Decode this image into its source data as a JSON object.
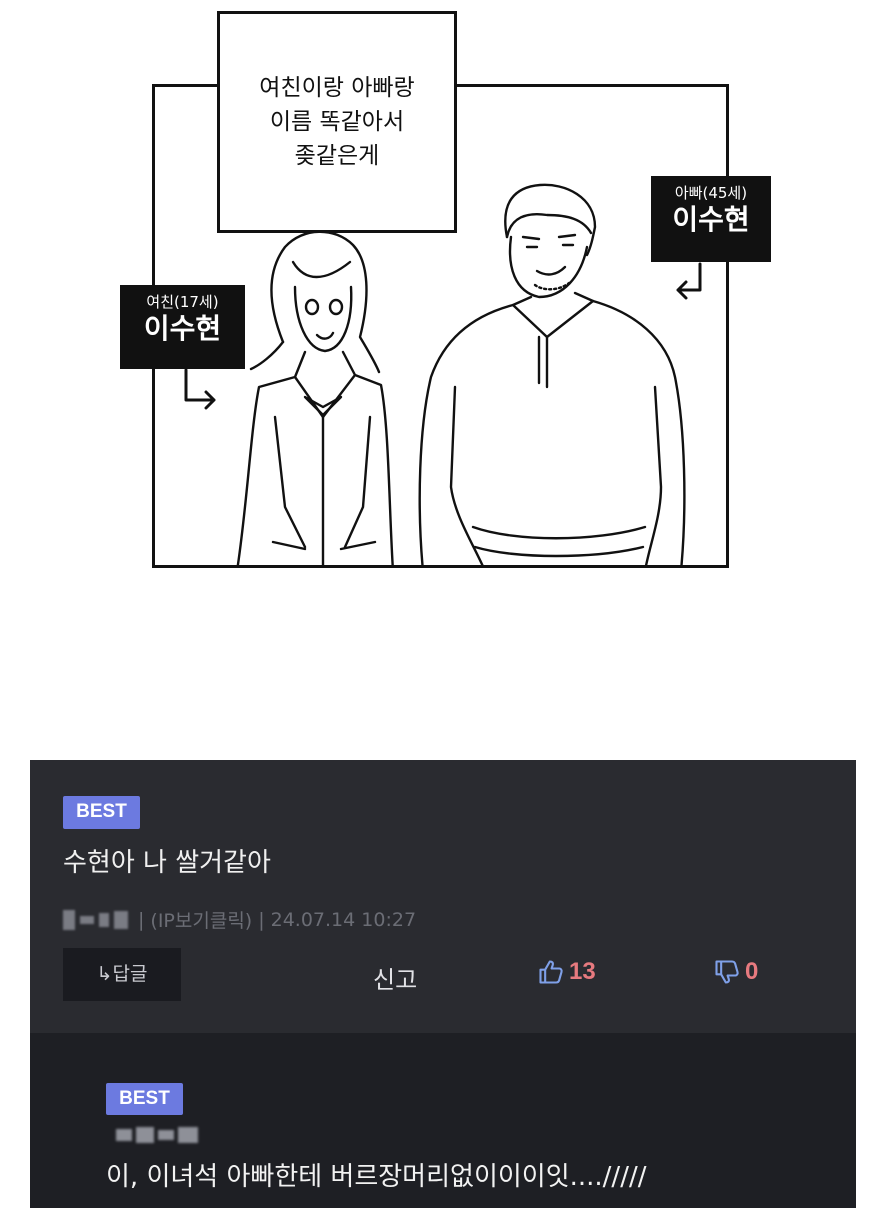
{
  "comic": {
    "caption": "여친이랑 아빠랑\n이름 똑같아서\n좆같은게",
    "girlfriend_tag": {
      "sub": "여친(17세)",
      "name": "이수현"
    },
    "dad_tag": {
      "sub": "아빠(45세)",
      "name": "이수현"
    }
  },
  "comments": [
    {
      "badge": "BEST",
      "text": "수현아 나 쌀거같아",
      "ip_link": "(IP보기클릭)",
      "separator": "|",
      "date": "24.07.14 10:27",
      "reply_label": "↳답글",
      "report_label": "신고",
      "likes": "13",
      "dislikes": "0"
    },
    {
      "badge": "BEST",
      "text": "이, 이녀석 아빠한테 버르장머리없이이이잇..../////"
    }
  ],
  "colors": {
    "badge": "#6c7ae0",
    "comment_bg": "#2a2b30",
    "reply_bg": "#1e1f24",
    "count_color": "#e77a7f",
    "thumb_color": "#7fa0e8"
  },
  "icons": {
    "like": "thumbs-up-icon",
    "dislike": "thumbs-down-icon"
  }
}
